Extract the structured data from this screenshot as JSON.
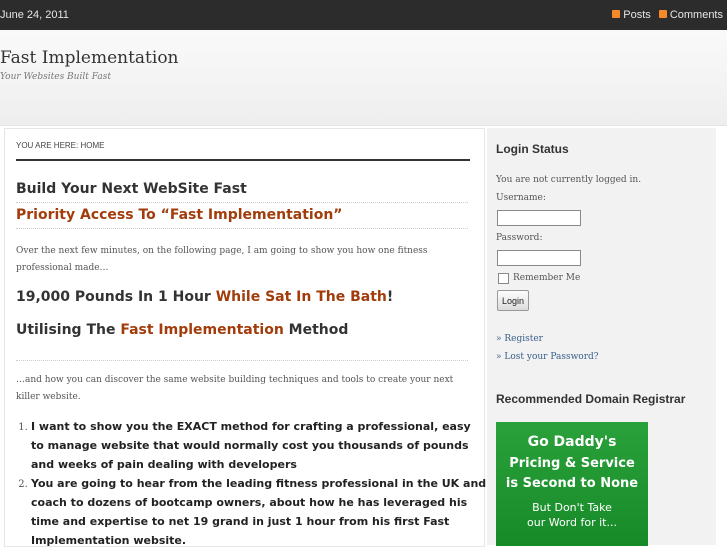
{
  "topbar": {
    "date": "June 24, 2011",
    "posts_label": "Posts",
    "comments_label": "Comments"
  },
  "header": {
    "site_title": "Fast Implementation",
    "tagline": "Your Websites Built Fast"
  },
  "breadcrumb": "YOU ARE HERE: HOME",
  "main": {
    "heading1": "Build Your Next WebSite Fast",
    "heading2": "Priority Access To “Fast Implementation”",
    "intro": "Over the next few minutes, on the following page, I am going to show you how one fitness professional made…",
    "sub1_pre": "19,000 Pounds In 1 Hour ",
    "sub1_accent": "While Sat In The Bath",
    "sub1_post": "!",
    "sub2_pre": "Utilising The ",
    "sub2_accent": "Fast Implementation",
    "sub2_post": " Method",
    "para2": "…and how you can discover the same website building techniques and tools to create your next killer website.",
    "list": [
      "I want to show you the EXACT method for crafting a professional, easy to manage website that would normally cost you thousands of pounds and weeks of pain dealing with developers",
      "You are going to hear from the leading fitness professional in the UK and coach to dozens of bootcamp owners, about how he has leveraged his time and expertise to net 19 grand in just 1 hour from his first Fast Implementation website."
    ]
  },
  "sidebar": {
    "login_heading": "Login Status",
    "status_text": "You are not currently logged in.",
    "username_label": "Username:",
    "password_label": "Password:",
    "remember_label": "Remember Me",
    "login_button": "Login",
    "register_link": "» Register",
    "lost_password_link": "» Lost your Password?",
    "registrar_heading": "Recommended Domain Registrar",
    "ad_lines": [
      "Go Daddy's",
      "Pricing & Service",
      "is Second to None",
      "But Don't Take",
      "our Word for it..."
    ]
  },
  "colors": {
    "accent": "#a23c0b",
    "topbar": "#2c2c2c",
    "rss": "#f68a2a",
    "ad_green": "#1f9a31"
  }
}
